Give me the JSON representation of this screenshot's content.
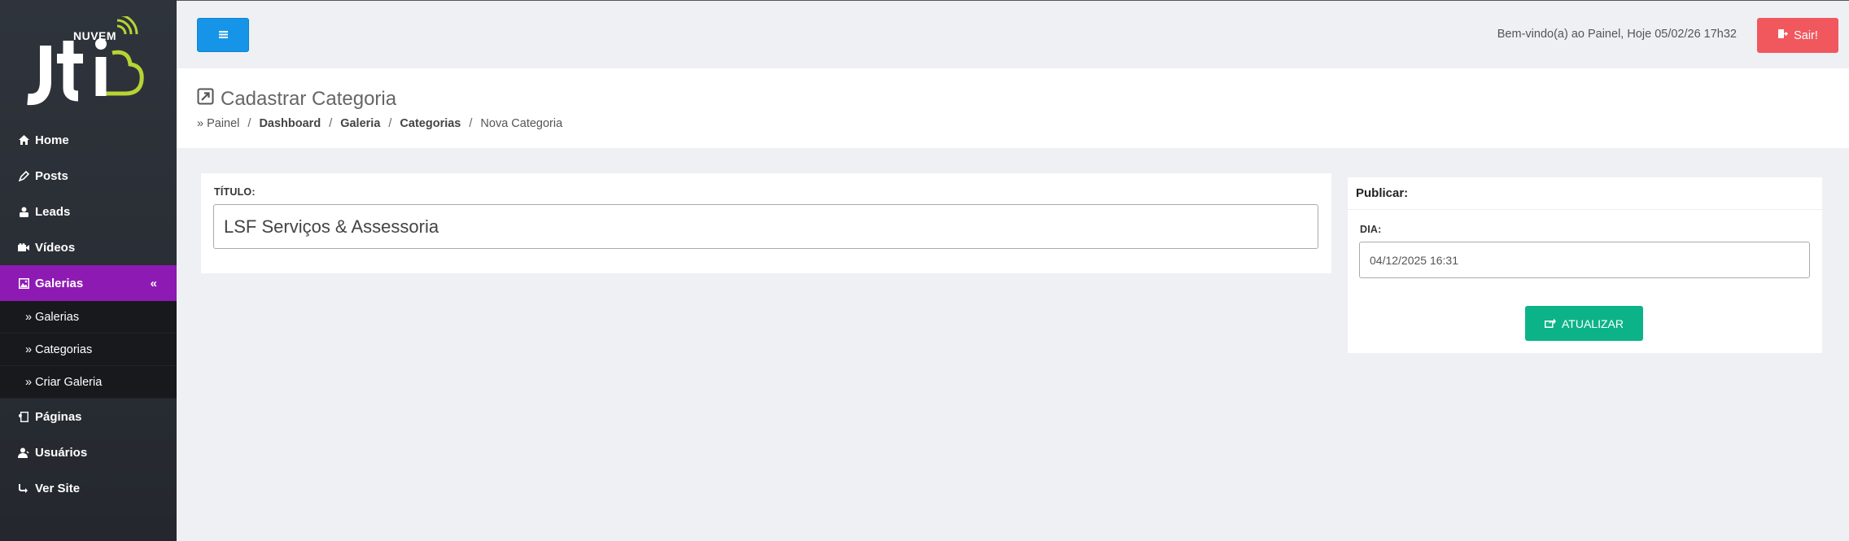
{
  "brand": {
    "logo_text": "Jti",
    "logo_sub": "NUVEM",
    "accent": "#8e1ab4"
  },
  "sidebar": {
    "items": [
      {
        "label": "Home",
        "icon": "home-icon"
      },
      {
        "label": "Posts",
        "icon": "pen-icon"
      },
      {
        "label": "Leads",
        "icon": "user-icon"
      },
      {
        "label": "Vídeos",
        "icon": "video-icon"
      },
      {
        "label": "Galerias",
        "icon": "image-icon",
        "active": true,
        "collapse": "«"
      },
      {
        "label": "Páginas",
        "icon": "page-icon"
      },
      {
        "label": "Usuários",
        "icon": "users-icon"
      },
      {
        "label": "Ver Site",
        "icon": "share-icon"
      }
    ],
    "subitems": [
      "» Galerias",
      "» Categorias",
      "» Criar Galeria"
    ]
  },
  "topbar": {
    "welcome": "Bem-vindo(a) ao Painel, Hoje 05/02/26 17h32",
    "logout_label": "Sair!"
  },
  "page": {
    "title": "Cadastrar Categoria",
    "breadcrumb": {
      "prefix": "» Painel",
      "links": [
        "Dashboard",
        "Galeria",
        "Categorias"
      ],
      "current": "Nova Categoria",
      "sep": "/"
    }
  },
  "form": {
    "title_label": "TÍTULO:",
    "title_value": "LSF Serviços & Assessoria"
  },
  "publish": {
    "heading": "Publicar:",
    "dia_label": "DIA:",
    "dia_value": "04/12/2025 16:31",
    "update_label": "ATUALIZAR"
  }
}
